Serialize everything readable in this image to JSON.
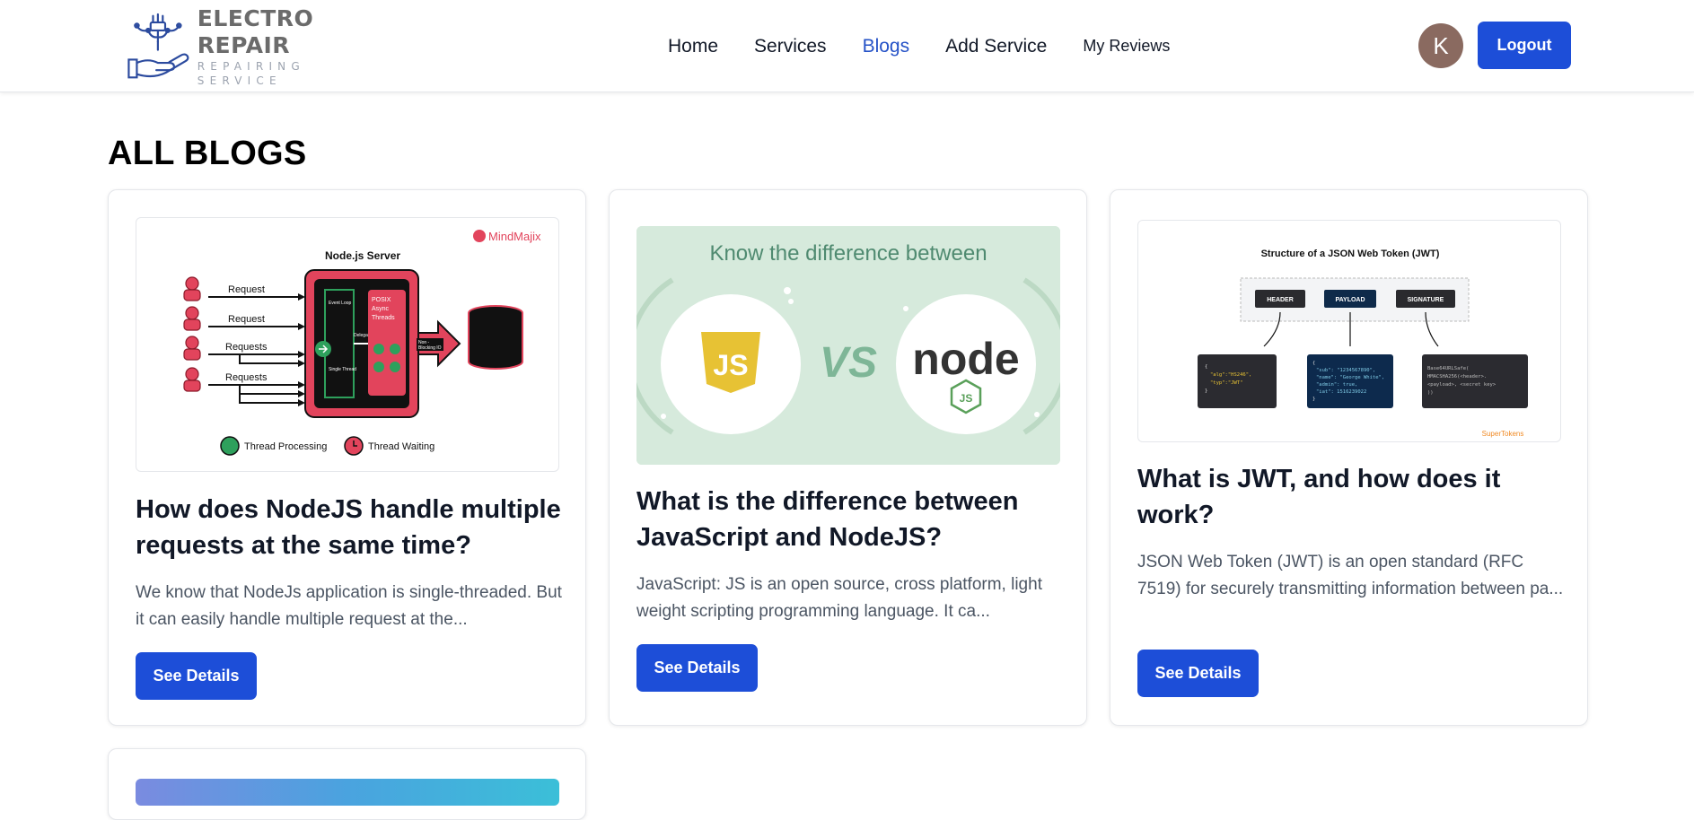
{
  "brand": {
    "title": "ELECTRO REPAIR",
    "subtitle": "REPAIRING SERVICE"
  },
  "nav": {
    "home": "Home",
    "services": "Services",
    "blogs": "Blogs",
    "add_service": "Add Service",
    "my_reviews": "My Reviews"
  },
  "user": {
    "avatar_initial": "K",
    "logout": "Logout"
  },
  "page": {
    "title": "ALL BLOGS"
  },
  "colors": {
    "primary": "#1d4ed8",
    "active_link": "#2552c7",
    "avatar_bg": "#8a6a60"
  },
  "blogs": [
    {
      "title": "How does NodeJS handle multiple requests at the same time?",
      "excerpt": "We know that NodeJs application is single-threaded. But it can easily handle multiple request at the...",
      "button": "See Details",
      "image": {
        "brand": "MindMajix",
        "heading": "Node.js Server",
        "requests": [
          "Request",
          "Request",
          "Requests",
          "Requests"
        ],
        "event_loop": "Event Loop",
        "single_thread": "Single Thread",
        "delegate": "Delegate",
        "posix": [
          "POSIX",
          "Async",
          "Threads"
        ],
        "non_blocking": [
          "Non -",
          "Blocking IO"
        ],
        "legend_processing": "Thread Processing",
        "legend_waiting": "Thread Waiting"
      }
    },
    {
      "title": "What is the difference between JavaScript and NodeJS?",
      "excerpt": "JavaScript: JS is an open source, cross platform, light weight scripting programming language. It ca...",
      "button": "See Details",
      "image": {
        "heading": "Know the difference between",
        "left": "JS",
        "vs": "VS",
        "right": "node",
        "right_badge": "JS"
      }
    },
    {
      "title": "What is JWT, and how does it work?",
      "excerpt": "JSON Web Token (JWT) is an open standard (RFC 7519) for securely transmitting information between pa...",
      "button": "See Details",
      "image": {
        "heading": "Structure of a JSON Web Token (JWT)",
        "header": "HEADER",
        "payload": "PAYLOAD",
        "signature": "SIGNATURE",
        "header_code": [
          "{",
          "\"alg\":\"HS246\",",
          "\"typ\":\"JWT\"",
          "}"
        ],
        "payload_code": [
          "{",
          "\"sub\": \"1234567890\",",
          "\"name\": \"George White\",",
          "\"admin\": true,",
          "\"iat\": 1516239022",
          "}"
        ],
        "signature_code": [
          "Base64URLSafe(",
          "HMACSHA256(<header>.",
          "<payload>, <secret key>",
          "))"
        ],
        "brand": "SuperTokens"
      }
    },
    {
      "title": "",
      "excerpt": "",
      "button": ""
    }
  ]
}
